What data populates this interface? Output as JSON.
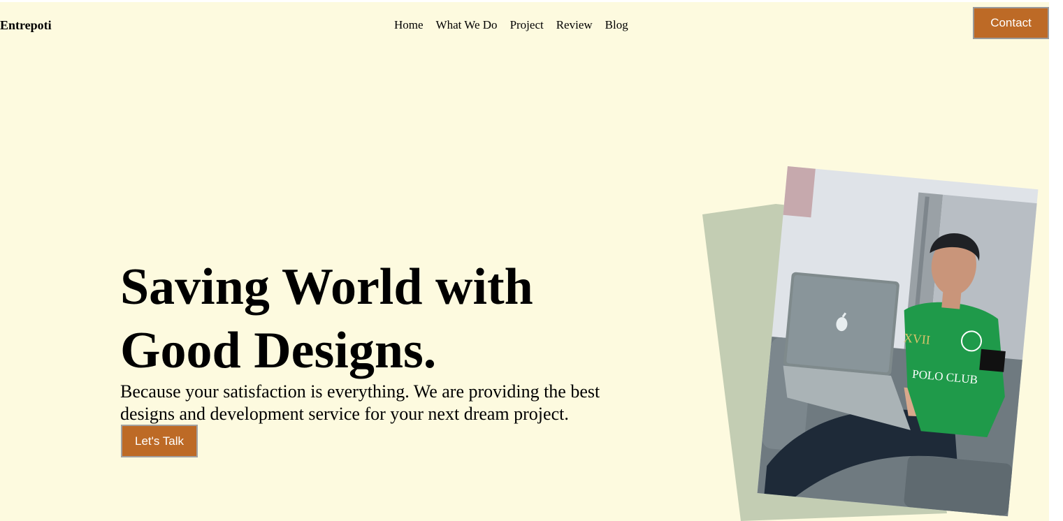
{
  "brand": {
    "name": "Entrepoti"
  },
  "nav": {
    "items": [
      {
        "label": "Home"
      },
      {
        "label": "What We Do"
      },
      {
        "label": "Project"
      },
      {
        "label": "Review"
      },
      {
        "label": "Blog"
      }
    ]
  },
  "header": {
    "contact_label": "Contact"
  },
  "hero": {
    "headline_line1": "Saving World with",
    "headline_line2": "Good Designs.",
    "subtext_line1": "Because your satisfaction is everything. We are providing the best",
    "subtext_line2": "designs and development service for your next dream project.",
    "cta_label": "Let's Talk",
    "photo": {
      "subject": "man-with-laptop",
      "laptop_icon": "apple-logo-icon",
      "shirt_text": "XVII",
      "shirt_text_2": "POLO CLUB"
    }
  },
  "colors": {
    "background": "#fdfadf",
    "accent": "#bd6a26",
    "accent_text": "#ffffff",
    "photo_backdrop": "#c3cdb3"
  }
}
